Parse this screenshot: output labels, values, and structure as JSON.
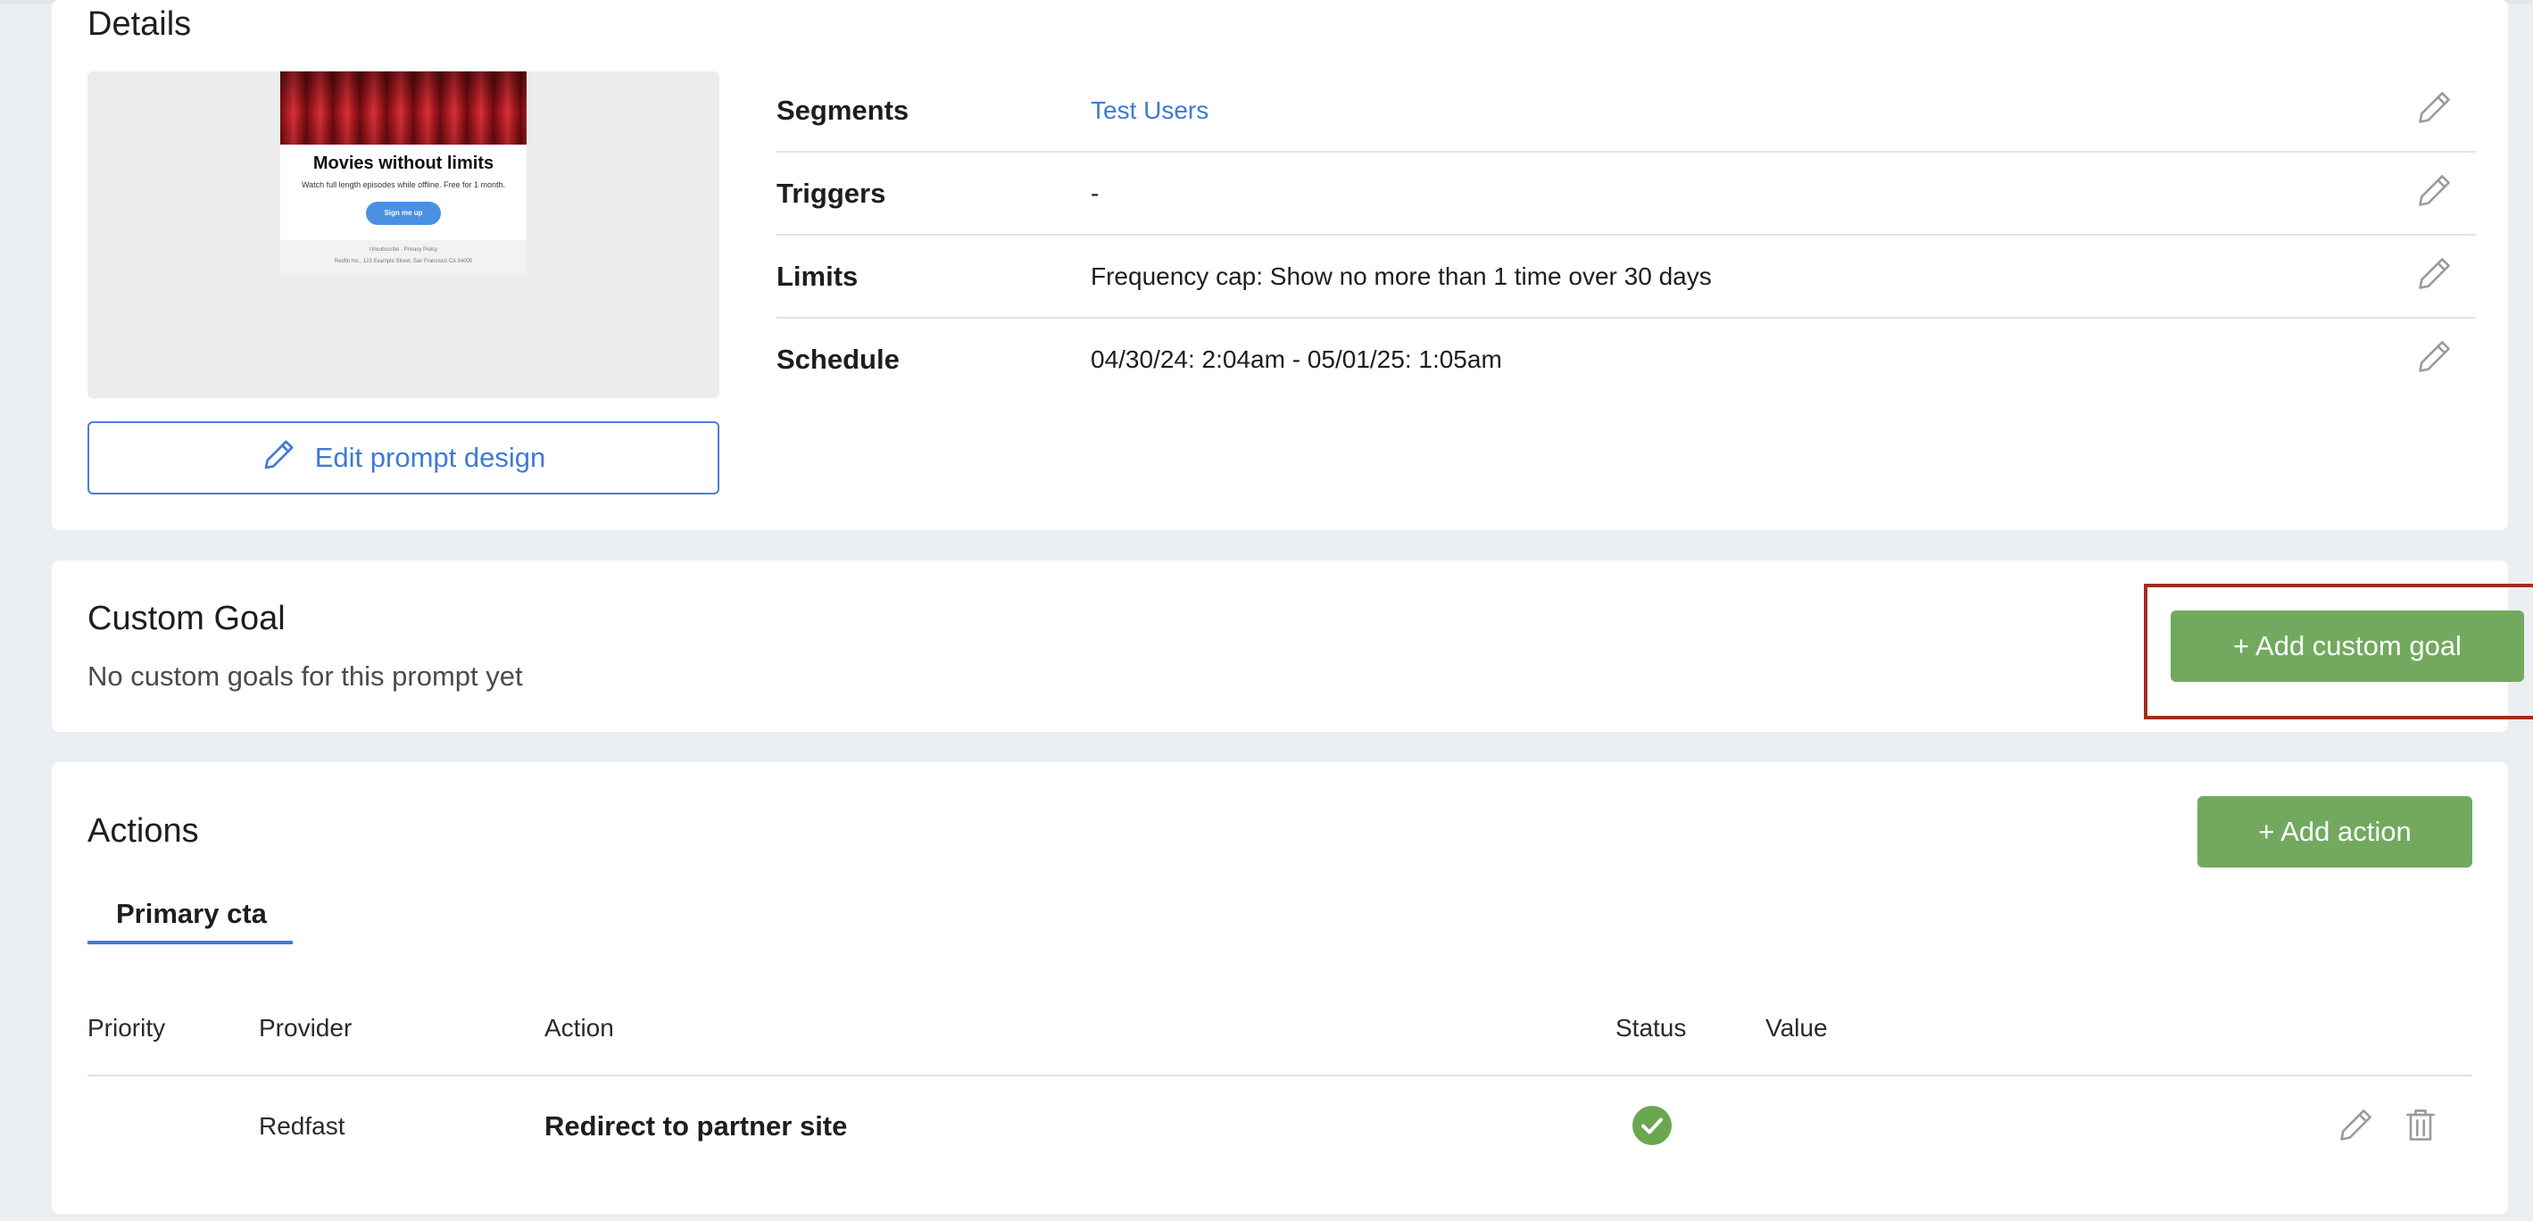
{
  "details": {
    "title": "Details",
    "preview": {
      "headline": "Movies without limits",
      "subtext": "Watch full length episodes while offline. Free for 1 month.",
      "button_label": "Sign me up",
      "footer_links": "Unsubscribe · Privacy Policy",
      "footer_address": "Redfin Inc., 123 Example Street, San Francisco CA 94000"
    },
    "edit_design_label": "Edit prompt design",
    "rows": [
      {
        "label": "Segments",
        "value": "Test Users"
      },
      {
        "label": "Triggers",
        "value": "-"
      },
      {
        "label": "Limits",
        "value": "Frequency cap: Show no more than 1 time over 30 days"
      },
      {
        "label": "Schedule",
        "value": "04/30/24: 2:04am - 05/01/25: 1:05am"
      }
    ]
  },
  "custom_goal": {
    "title": "Custom Goal",
    "empty_text": "No custom goals for this prompt yet",
    "add_label": "+ Add custom goal"
  },
  "actions": {
    "title": "Actions",
    "add_label": "+ Add action",
    "tabs": [
      {
        "label": "Primary cta"
      }
    ],
    "columns": [
      "Priority",
      "Provider",
      "Action",
      "Status",
      "Value"
    ],
    "rows": [
      {
        "priority": "",
        "provider": "Redfast",
        "action": "Redirect to partner site",
        "status": "active",
        "value": ""
      }
    ]
  },
  "colors": {
    "accent_blue": "#3f7ad9",
    "action_green": "#72a95f",
    "status_green": "#6aa84f",
    "highlight_red": "#a32c1f",
    "page_bg": "#ebeff3"
  },
  "icons": {
    "edit": "pencil-icon",
    "delete": "trash-icon",
    "status": "check-circle-icon"
  }
}
